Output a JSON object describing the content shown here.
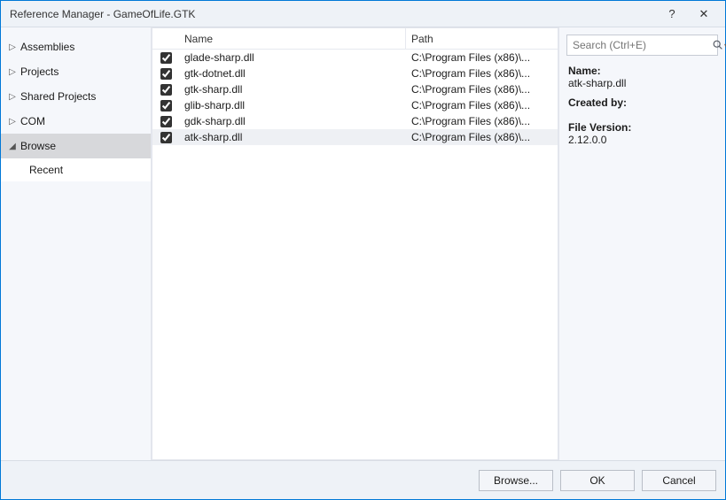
{
  "window": {
    "title": "Reference Manager - GameOfLife.GTK",
    "help": "?",
    "close": "✕"
  },
  "search": {
    "placeholder": "Search (Ctrl+E)"
  },
  "nav": {
    "items": [
      {
        "label": "Assemblies",
        "expanded": false
      },
      {
        "label": "Projects",
        "expanded": false
      },
      {
        "label": "Shared Projects",
        "expanded": false
      },
      {
        "label": "COM",
        "expanded": false
      },
      {
        "label": "Browse",
        "expanded": true,
        "selected": true,
        "children": [
          {
            "label": "Recent",
            "selected": true
          }
        ]
      }
    ]
  },
  "list": {
    "columns": {
      "name": "Name",
      "path": "Path"
    },
    "rows": [
      {
        "checked": true,
        "name": "glade-sharp.dll",
        "path": "C:\\Program Files (x86)\\..."
      },
      {
        "checked": true,
        "name": "gtk-dotnet.dll",
        "path": "C:\\Program Files (x86)\\..."
      },
      {
        "checked": true,
        "name": "gtk-sharp.dll",
        "path": "C:\\Program Files (x86)\\..."
      },
      {
        "checked": true,
        "name": "glib-sharp.dll",
        "path": "C:\\Program Files (x86)\\..."
      },
      {
        "checked": true,
        "name": "gdk-sharp.dll",
        "path": "C:\\Program Files (x86)\\..."
      },
      {
        "checked": true,
        "name": "atk-sharp.dll",
        "path": "C:\\Program Files (x86)\\...",
        "selected": true
      }
    ]
  },
  "details": {
    "name_label": "Name:",
    "name_value": "atk-sharp.dll",
    "createdby_label": "Created by:",
    "createdby_value": "",
    "fileversion_label": "File Version:",
    "fileversion_value": "2.12.0.0"
  },
  "footer": {
    "browse": "Browse...",
    "ok": "OK",
    "cancel": "Cancel"
  },
  "glyphs": {
    "collapsed": "▷",
    "expanded": "◢"
  }
}
